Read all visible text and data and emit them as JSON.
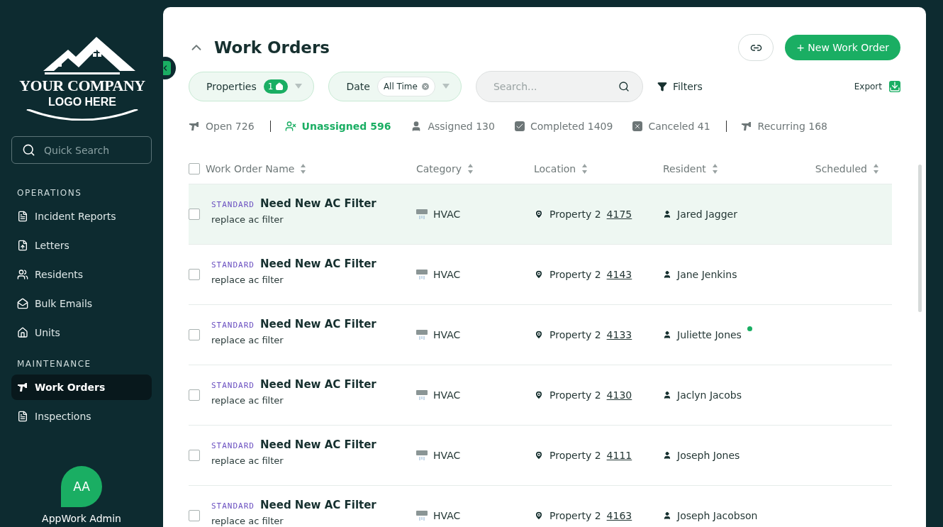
{
  "sidebar": {
    "logo": {
      "line1": "YOUR COMPANY",
      "line2": "LOGO HERE"
    },
    "collapse_expanded": true,
    "search": {
      "placeholder": "Quick Search"
    },
    "sections": [
      {
        "title": "OPERATIONS",
        "items": [
          {
            "label": "Incident Reports",
            "selected": false
          },
          {
            "label": "Letters",
            "selected": false
          },
          {
            "label": "Residents",
            "selected": false
          },
          {
            "label": "Bulk Emails",
            "selected": false
          },
          {
            "label": "Units",
            "selected": false
          }
        ]
      },
      {
        "title": "MAINTENANCE",
        "items": [
          {
            "label": "Work Orders",
            "selected": true
          },
          {
            "label": "Inspections",
            "selected": false
          }
        ]
      }
    ],
    "user": {
      "initials": "AA",
      "name": "AppWork Admin"
    }
  },
  "header": {
    "title": "Work Orders",
    "expanded": true,
    "new_button": "+ New Work Order"
  },
  "filters": {
    "properties": {
      "label": "Properties",
      "count": "1"
    },
    "date": {
      "label": "Date",
      "value": "All Time"
    },
    "search": {
      "placeholder": "Search..."
    },
    "filters_label": "Filters",
    "export_label": "Export"
  },
  "status_tabs": [
    {
      "label": "Open 726",
      "selected": false,
      "divider_after": true
    },
    {
      "label": "Unassigned 596",
      "selected": true,
      "divider_after": false
    },
    {
      "label": "Assigned 130",
      "selected": false,
      "divider_after": false
    },
    {
      "label": "Completed 1409",
      "selected": false,
      "divider_after": false
    },
    {
      "label": "Canceled 41",
      "selected": false,
      "divider_after": true
    },
    {
      "label": "Recurring 168",
      "selected": false,
      "divider_after": false
    }
  ],
  "table": {
    "all_checked": false,
    "columns": [
      "Work Order Name",
      "Category",
      "Location",
      "Resident",
      "Scheduled"
    ],
    "rows": [
      {
        "type": "STANDARD",
        "name": "Need New AC Filter",
        "description": "replace ac filter",
        "category": "HVAC",
        "property": "Property 2",
        "unit": "4175",
        "resident": "Jared Jagger",
        "online": false,
        "highlighted": true,
        "checked": false
      },
      {
        "type": "STANDARD",
        "name": "Need New AC Filter",
        "description": "replace ac filter",
        "category": "HVAC",
        "property": "Property 2",
        "unit": "4143",
        "resident": "Jane Jenkins",
        "online": false,
        "highlighted": false,
        "checked": false
      },
      {
        "type": "STANDARD",
        "name": "Need New AC Filter",
        "description": "replace ac filter",
        "category": "HVAC",
        "property": "Property 2",
        "unit": "4133",
        "resident": "Juliette Jones",
        "online": true,
        "highlighted": false,
        "checked": false
      },
      {
        "type": "STANDARD",
        "name": "Need New AC Filter",
        "description": "replace ac filter",
        "category": "HVAC",
        "property": "Property 2",
        "unit": "4130",
        "resident": "Jaclyn Jacobs",
        "online": false,
        "highlighted": false,
        "checked": false
      },
      {
        "type": "STANDARD",
        "name": "Need New AC Filter",
        "description": "replace ac filter",
        "category": "HVAC",
        "property": "Property 2",
        "unit": "4111",
        "resident": "Joseph Jones",
        "online": false,
        "highlighted": false,
        "checked": false
      },
      {
        "type": "STANDARD",
        "name": "Need New AC Filter",
        "description": "replace ac filter",
        "category": "HVAC",
        "property": "Property 2",
        "unit": "4163",
        "resident": "Joseph Jacobson",
        "online": false,
        "highlighted": false,
        "checked": false
      }
    ]
  }
}
